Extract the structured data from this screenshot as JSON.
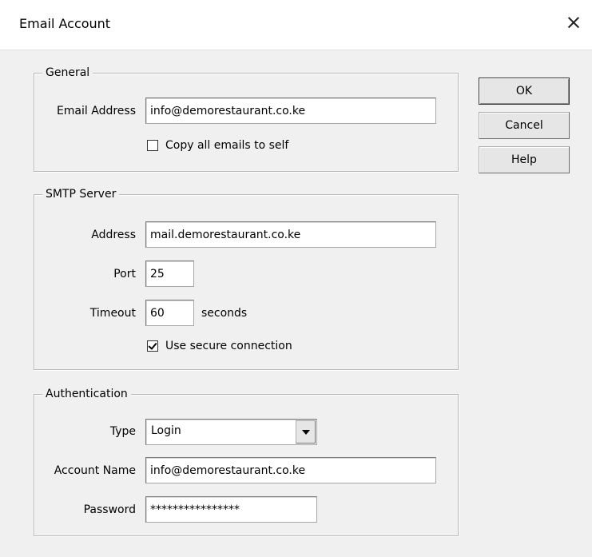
{
  "window": {
    "title": "Email Account",
    "close_icon": "×"
  },
  "general": {
    "legend": "General",
    "email_address_label": "Email Address",
    "email_address_value": "info@demorestaurant.co.ke",
    "copy_self_label": "Copy all emails to self",
    "copy_self_checked": false
  },
  "smtp": {
    "legend": "SMTP Server",
    "address_label": "Address",
    "address_value": "mail.demorestaurant.co.ke",
    "port_label": "Port",
    "port_value": "25",
    "timeout_label": "Timeout",
    "timeout_value": "60",
    "timeout_unit": "seconds",
    "secure_label": "Use secure connection",
    "secure_checked": true
  },
  "auth": {
    "legend": "Authentication",
    "type_label": "Type",
    "type_value": "Login",
    "account_label": "Account Name",
    "account_value": "info@demorestaurant.co.ke",
    "password_label": "Password",
    "password_value": "****************"
  },
  "buttons": {
    "ok": "OK",
    "cancel": "Cancel",
    "help": "Help"
  }
}
